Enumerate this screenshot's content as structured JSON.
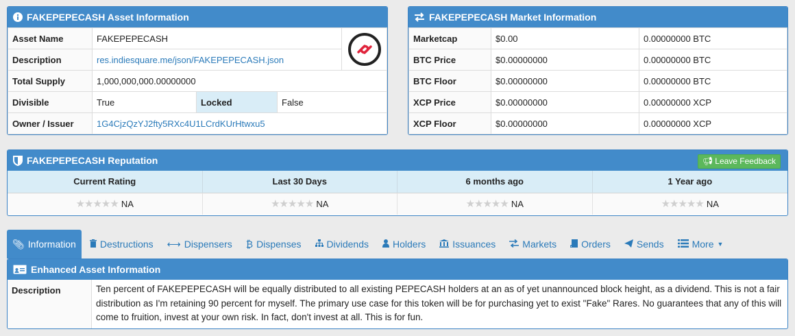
{
  "asset_panel": {
    "title": "FAKEPEPECASH Asset Information",
    "asset_name_label": "Asset Name",
    "asset_name": "FAKEPEPECASH",
    "description_label": "Description",
    "description": "res.indiesquare.me/json/FAKEPEPECASH.json",
    "total_supply_label": "Total Supply",
    "total_supply": "1,000,000,000.00000000",
    "divisible_label": "Divisible",
    "divisible": "True",
    "locked_label": "Locked",
    "locked": "False",
    "owner_label": "Owner / Issuer",
    "owner": "1G4CjzQzYJ2fty5RXc4U1LCrdKUrHtwxu5"
  },
  "market_panel": {
    "title": "FAKEPEPECASH Market Information",
    "rows": [
      {
        "label": "Marketcap",
        "usd": "$0.00",
        "alt": "0.00000000 BTC"
      },
      {
        "label": "BTC Price",
        "usd": "$0.00000000",
        "alt": "0.00000000 BTC"
      },
      {
        "label": "BTC Floor",
        "usd": "$0.00000000",
        "alt": "0.00000000 BTC"
      },
      {
        "label": "XCP Price",
        "usd": "$0.00000000",
        "alt": "0.00000000 XCP"
      },
      {
        "label": "XCP Floor",
        "usd": "$0.00000000",
        "alt": "0.00000000 XCP"
      }
    ]
  },
  "reputation": {
    "title": "FAKEPEPECASH Reputation",
    "feedback_label": "Leave Feedback",
    "columns": [
      {
        "header": "Current Rating",
        "value": "NA"
      },
      {
        "header": "Last 30 Days",
        "value": "NA"
      },
      {
        "header": "6 months ago",
        "value": "NA"
      },
      {
        "header": "1 Year ago",
        "value": "NA"
      }
    ]
  },
  "tabs": [
    {
      "label": "Information",
      "icon": "paperclip-icon"
    },
    {
      "label": "Destructions",
      "icon": "trash-icon"
    },
    {
      "label": "Dispensers",
      "icon": "arrows-horizontal-icon"
    },
    {
      "label": "Dispenses",
      "icon": "bitcoin-icon"
    },
    {
      "label": "Dividends",
      "icon": "sitemap-icon"
    },
    {
      "label": "Holders",
      "icon": "user-icon"
    },
    {
      "label": "Issuances",
      "icon": "bank-icon"
    },
    {
      "label": "Markets",
      "icon": "exchange-icon"
    },
    {
      "label": "Orders",
      "icon": "book-icon"
    },
    {
      "label": "Sends",
      "icon": "paper-plane-icon"
    },
    {
      "label": "More",
      "icon": "list-icon"
    }
  ],
  "enhanced": {
    "title": "Enhanced Asset Information",
    "description_label": "Description",
    "description": "Ten percent of FAKEPEPECASH will be equally distributed to all existing PEPECASH holders at an as of yet unannounced block height, as a dividend. This is not a fair distribution as I'm retaining 90 percent for myself. The primary use case for this token will be for purchasing yet to exist \"Fake\" Rares. No guarantees that any of this will come to fruition, invest at your own risk. In fact, don't invest at all. This is for fun."
  },
  "colors": {
    "header_blue": "#428bca",
    "link_blue": "#2a7ab9",
    "feedback_green": "#5cb85c",
    "logo_red": "#e0243c"
  }
}
